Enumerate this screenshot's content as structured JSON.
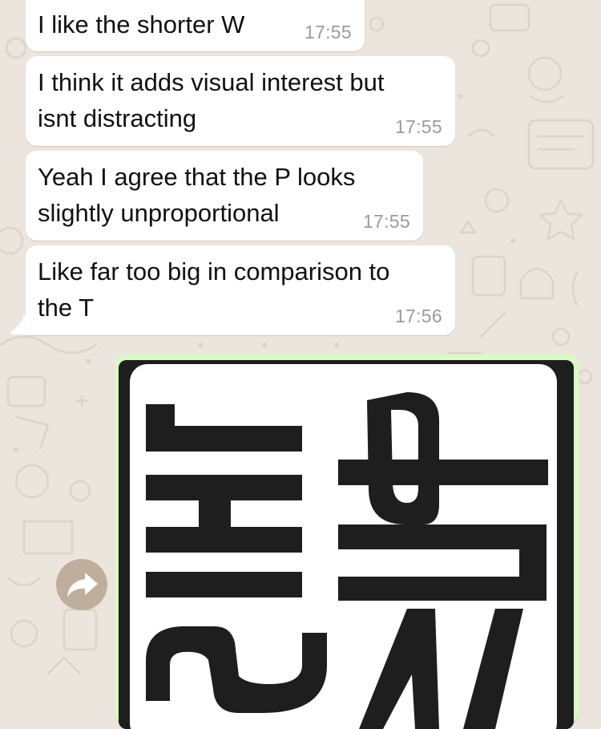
{
  "messages": [
    {
      "text": "I like the shorter W",
      "time": "17:55"
    },
    {
      "text": "I think it adds visual interest but\nisnt distracting",
      "time": "17:55"
    },
    {
      "text": "Yeah I agree that the P looks\nslightly unproportional",
      "time": "17:55"
    },
    {
      "text": "Like far too big in comparison to\nthe T",
      "time": "17:56"
    }
  ],
  "image_message": {
    "content": "logo artwork"
  },
  "icons": {
    "forward": "forward-arrow-icon"
  },
  "colors": {
    "wallpaper": "#ece5dd",
    "incoming_bubble": "#ffffff",
    "outgoing_bubble": "#dcf8c6",
    "timestamp": "#9a9a9a",
    "forward_button": "#bfae9c",
    "logo_ink": "#1e1e1e"
  }
}
